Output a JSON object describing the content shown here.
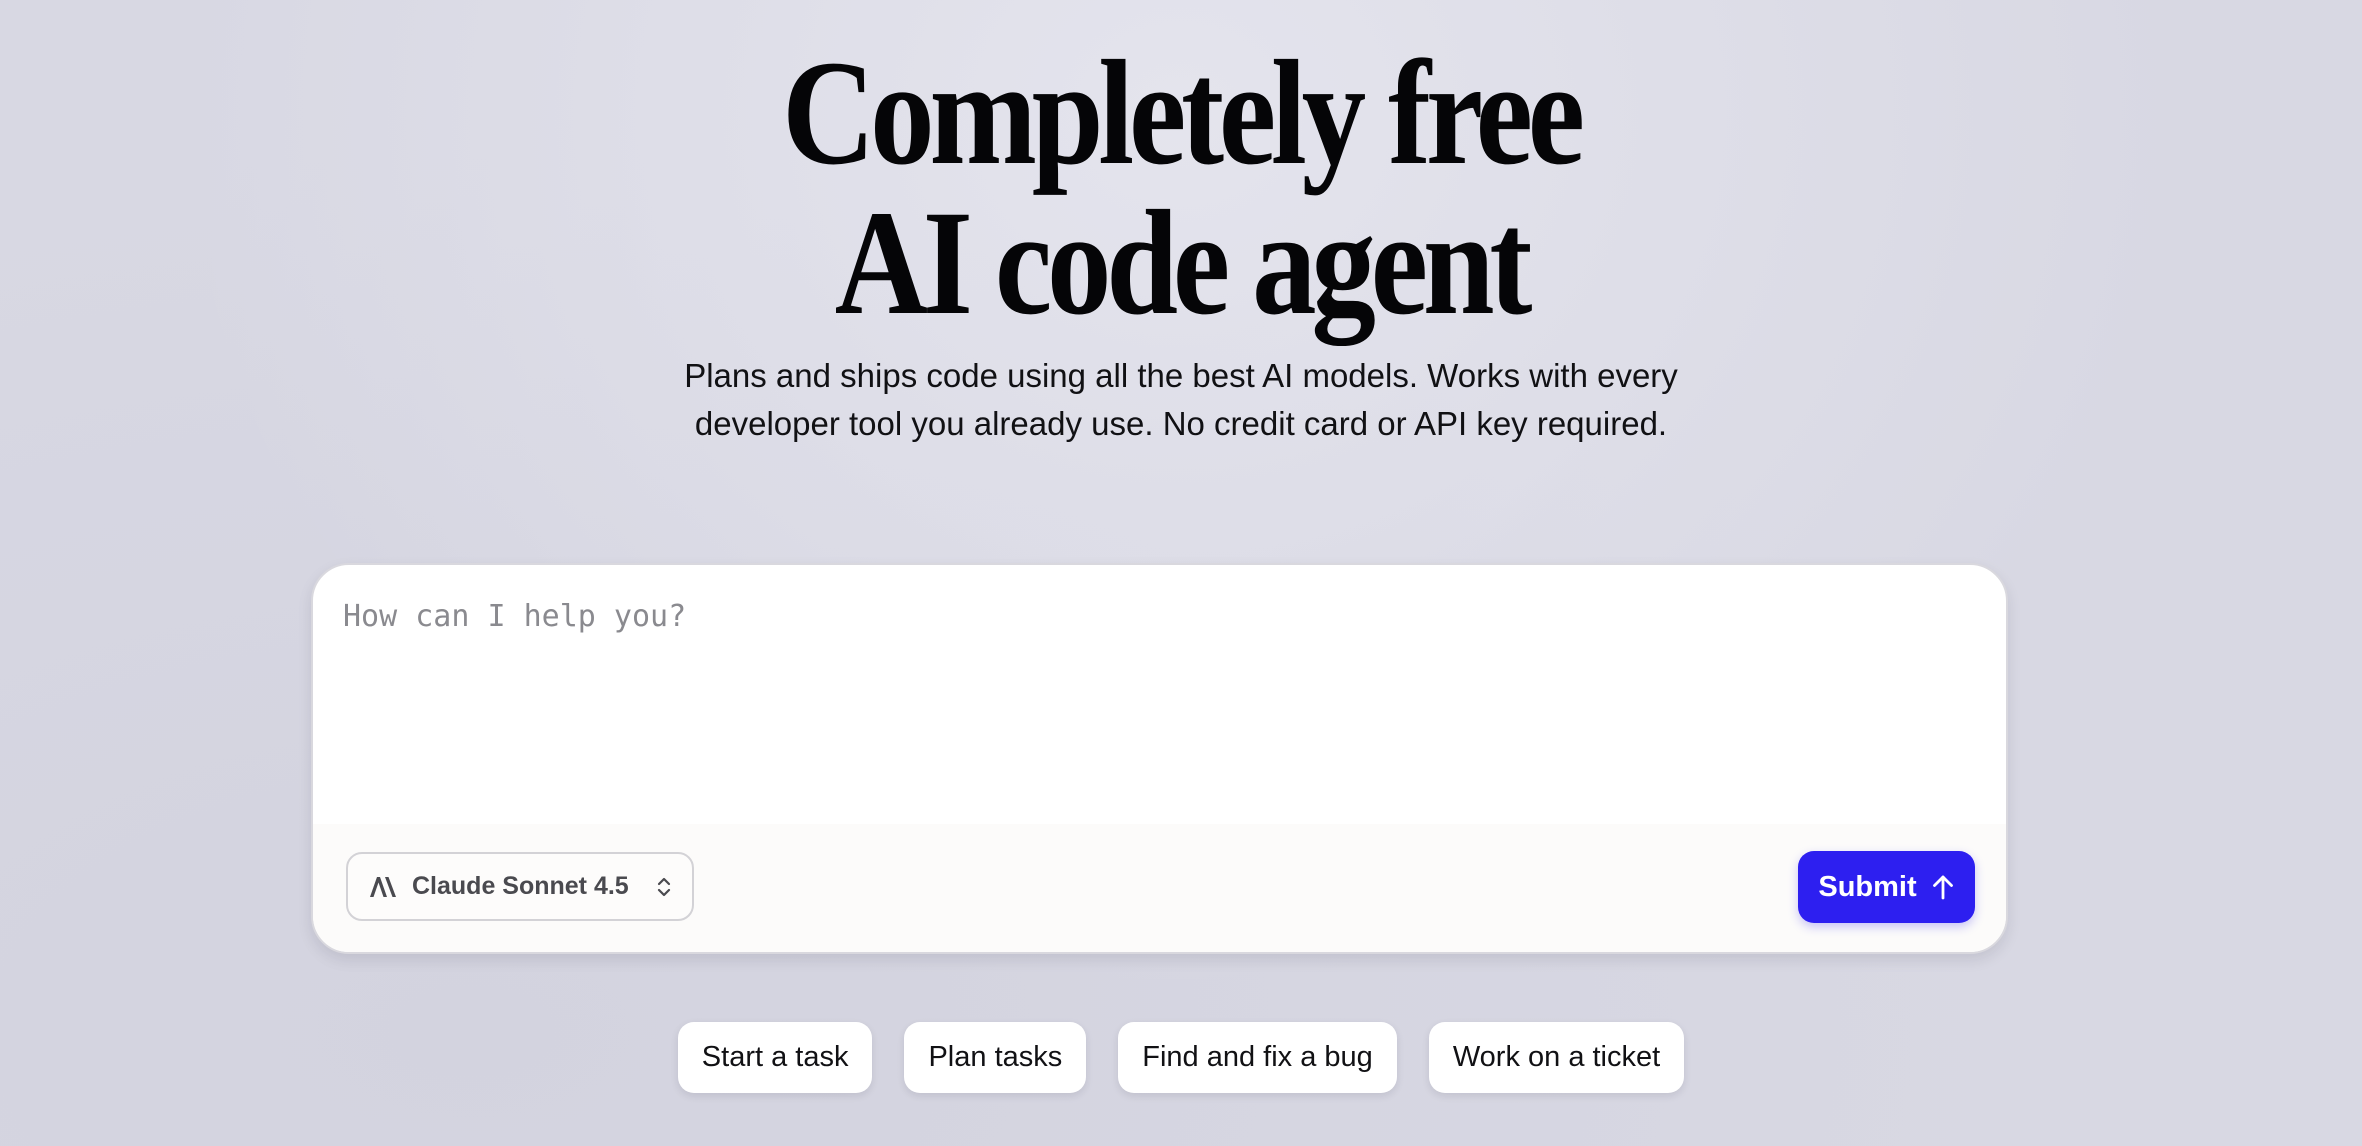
{
  "hero": {
    "headline_line1": "Completely free",
    "headline_line2": "AI code agent",
    "subtitle_line1": "Plans and ships code using all the best AI models. Works with every",
    "subtitle_line2": "developer tool you already use. No credit card or API key required."
  },
  "composer": {
    "placeholder": "How can I help you?",
    "value": "",
    "model_select": {
      "icon": "anthropic-logo-icon",
      "selected": "Claude Sonnet 4.5",
      "chevron_icon": "chevron-updown-icon"
    },
    "submit": {
      "label": "Submit",
      "icon": "arrow-up-icon"
    }
  },
  "suggestions": [
    {
      "label": "Start a task"
    },
    {
      "label": "Plan tasks"
    },
    {
      "label": "Find and fix a bug"
    },
    {
      "label": "Work on a ticket"
    }
  ],
  "colors": {
    "background": "#d8d8e3",
    "accent": "#2d1ff0",
    "panel": "#ffffff",
    "text": "#0b0b0f"
  }
}
